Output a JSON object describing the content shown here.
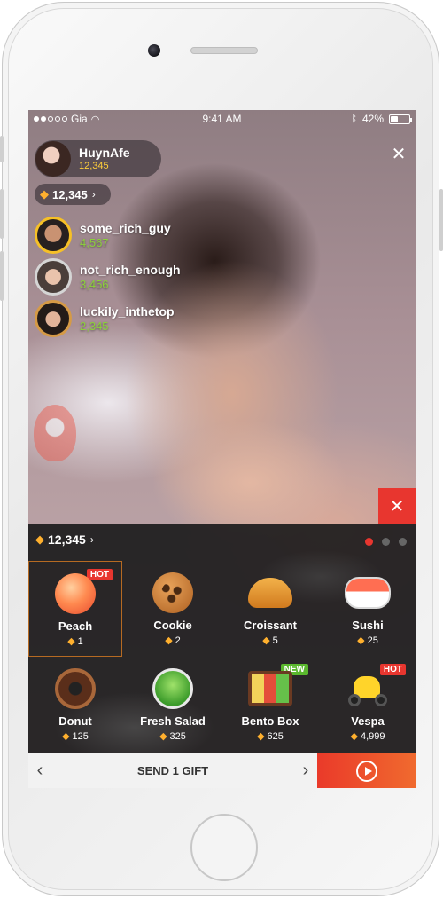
{
  "status_bar": {
    "carrier": "Gia",
    "time": "9:41 AM",
    "battery": "42%",
    "battery_level": 0.42
  },
  "host": {
    "name": "HuynAfe",
    "count": "12,345"
  },
  "points": {
    "value": "12,345",
    "chevron": "›"
  },
  "leaderboard": [
    {
      "name": "some_rich_guy",
      "count": "4,567",
      "rank": "gold"
    },
    {
      "name": "not_rich_enough",
      "count": "3,456",
      "rank": "silver"
    },
    {
      "name": "luckily_inthetop",
      "count": "2,345",
      "rank": "bronze"
    }
  ],
  "gift_panel": {
    "balance": "12,345",
    "chevron": "›",
    "page_count": 3,
    "active_page": 1,
    "gifts": [
      {
        "name": "Peach",
        "price": "1",
        "badge": "HOT",
        "selected": true,
        "icon": "peach-icon"
      },
      {
        "name": "Cookie",
        "price": "2",
        "badge": "",
        "selected": false,
        "icon": "cookie-icon"
      },
      {
        "name": "Croissant",
        "price": "5",
        "badge": "",
        "selected": false,
        "icon": "croissant-icon"
      },
      {
        "name": "Sushi",
        "price": "25",
        "badge": "",
        "selected": false,
        "icon": "sushi-icon"
      },
      {
        "name": "Donut",
        "price": "125",
        "badge": "",
        "selected": false,
        "icon": "donut-icon"
      },
      {
        "name": "Fresh Salad",
        "price": "325",
        "badge": "",
        "selected": false,
        "icon": "salad-icon"
      },
      {
        "name": "Bento Box",
        "price": "625",
        "badge": "NEW",
        "selected": false,
        "icon": "bento-icon"
      },
      {
        "name": "Vespa",
        "price": "4,999",
        "badge": "HOT",
        "selected": false,
        "icon": "vespa-icon"
      }
    ]
  },
  "send_bar": {
    "label": "SEND 1 GIFT",
    "prev": "‹",
    "next": "›"
  },
  "colors": {
    "accent": "#e8362f",
    "gold": "#ffcf3a",
    "green_count": "#8bd13a",
    "new_badge": "#5ab82e"
  }
}
